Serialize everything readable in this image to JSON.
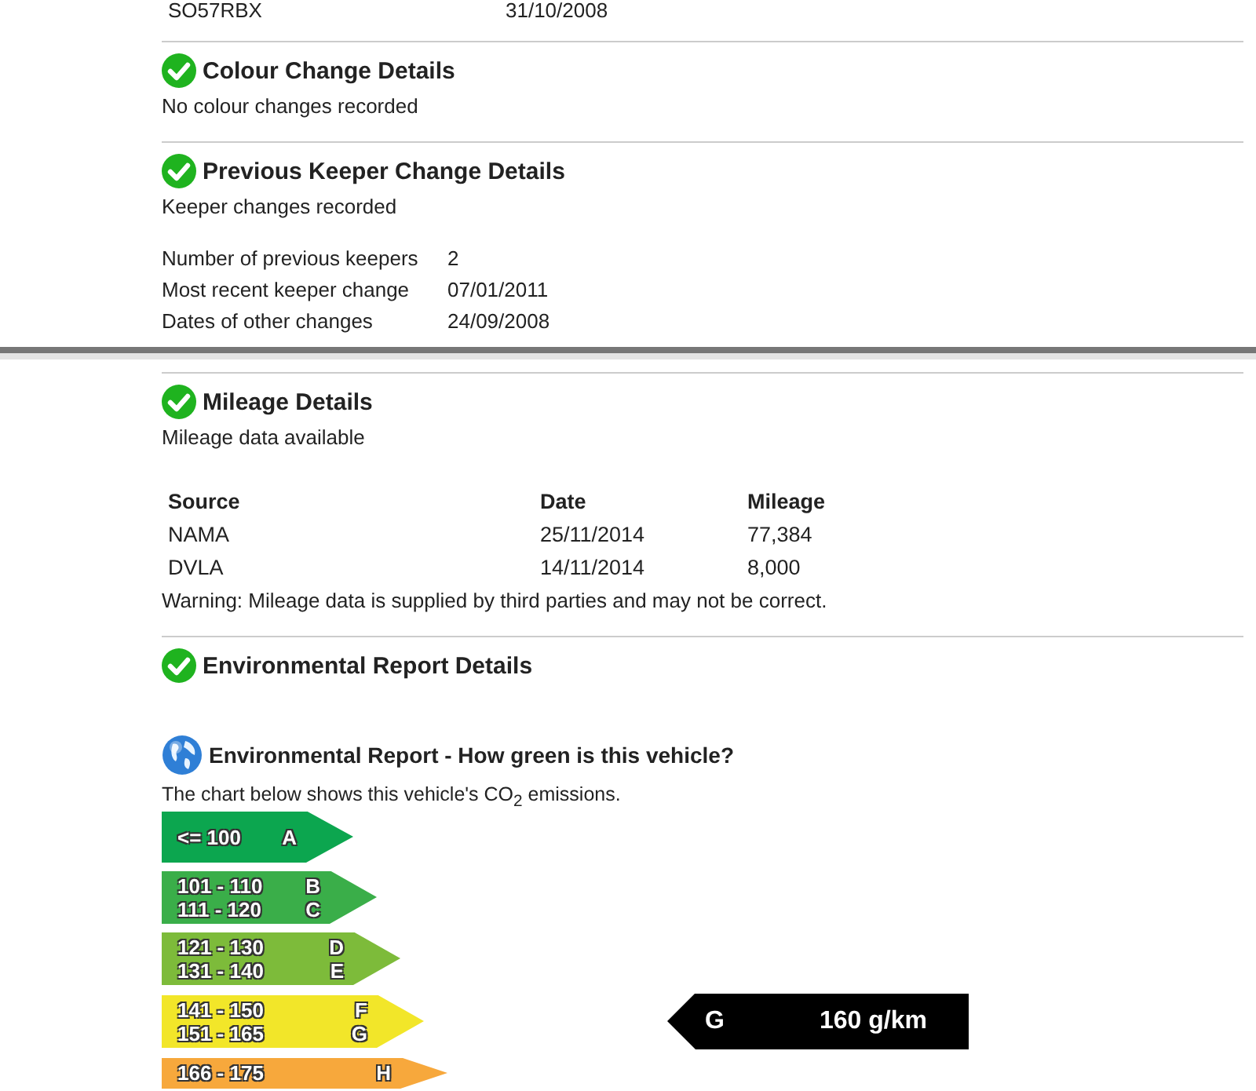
{
  "top_row": {
    "column_1": "SO57RBX",
    "column_2": "31/10/2008"
  },
  "pages": [
    {
      "sections": [
        {
          "kind": "plain",
          "title": "Colour Change Details",
          "status": "No colour changes recorded"
        },
        {
          "kind": "details",
          "title": "Previous Keeper Change Details",
          "status": "Keeper changes recorded",
          "details": [
            {
              "label": "Number of previous keepers",
              "value": "2"
            },
            {
              "label": "Most recent keeper change",
              "value": "07/01/2011"
            },
            {
              "label": "Dates of other changes",
              "value": "24/09/2008"
            }
          ]
        }
      ]
    },
    {
      "sections": [
        {
          "kind": "table",
          "title": "Mileage Details",
          "status": "Mileage data available",
          "columns": [
            "Source",
            "Date",
            "Mileage"
          ],
          "rows": [
            [
              "NAMA",
              "25/11/2014",
              "77,384"
            ],
            [
              "DVLA",
              "14/11/2014",
              "8,000"
            ]
          ],
          "note": "Warning: Mileage data is supplied by third parties and may not be correct."
        },
        {
          "kind": "heading",
          "title": "Environmental Report Details"
        }
      ]
    }
  ],
  "environmental_report": {
    "title": "Environmental Report - How green is this vehicle?",
    "intro": "The chart below shows this vehicle's CO$_{2}$ emissions.",
    "bands": [
      {
        "color": "#0ca64f",
        "rows": [
          {
            "range": "<= 100",
            "letter": "A"
          }
        ]
      },
      {
        "color": "#3aae49",
        "rows": [
          {
            "range": "101 - 110",
            "letter": "B"
          },
          {
            "range": "111 - 120",
            "letter": "C"
          }
        ]
      },
      {
        "color": "#7dbb3a",
        "rows": [
          {
            "range": "121 - 130",
            "letter": "D"
          },
          {
            "range": "131 - 140",
            "letter": "E"
          }
        ]
      },
      {
        "color": "#f2e629",
        "rows": [
          {
            "range": "141 - 150",
            "letter": "F"
          },
          {
            "range": "151 - 165",
            "letter": "G"
          }
        ],
        "indicator": {
          "letter": "G",
          "reading": "160 g/km"
        }
      },
      {
        "color": "#f7a83c",
        "rows": [
          {
            "range": "166 - 175",
            "letter": "H"
          }
        ]
      }
    ]
  }
}
